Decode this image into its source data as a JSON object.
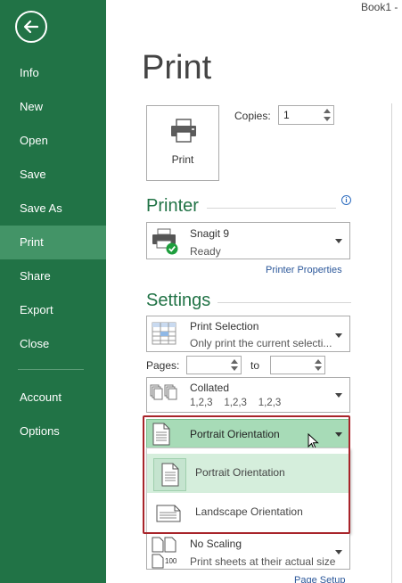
{
  "window": {
    "title": "Book1 -"
  },
  "sidebar": {
    "items": [
      {
        "label": "Info"
      },
      {
        "label": "New"
      },
      {
        "label": "Open"
      },
      {
        "label": "Save"
      },
      {
        "label": "Save As"
      },
      {
        "label": "Print"
      },
      {
        "label": "Share"
      },
      {
        "label": "Export"
      },
      {
        "label": "Close"
      },
      {
        "label": "Account"
      },
      {
        "label": "Options"
      }
    ],
    "active": "Print",
    "color": "#217346",
    "active_color": "#439467"
  },
  "page": {
    "title": "Print"
  },
  "print_button": {
    "label": "Print",
    "icon": "printer-icon"
  },
  "copies": {
    "label": "Copies:",
    "value": "1"
  },
  "printer": {
    "heading": "Printer",
    "name": "Snagit 9",
    "status": "Ready",
    "properties_link": "Printer Properties"
  },
  "settings": {
    "heading": "Settings",
    "print_what": {
      "title": "Print Selection",
      "description": "Only print the current selecti..."
    },
    "pages": {
      "label": "Pages:",
      "to_label": "to",
      "from": "",
      "to": ""
    },
    "collation": {
      "title": "Collated",
      "description": "1,2,3    1,2,3    1,2,3"
    },
    "orientation": {
      "selected": "Portrait Orientation",
      "options": [
        {
          "label": "Portrait Orientation"
        },
        {
          "label": "Landscape Orientation"
        }
      ],
      "hovered": "Portrait Orientation"
    },
    "scaling": {
      "title": "No Scaling",
      "description": "Print sheets at their actual size",
      "icon_text": "100"
    },
    "page_setup_link": "Page Setup"
  },
  "colors": {
    "accent": "#217346",
    "highlight_border": "#a8242a",
    "selected_bg": "#a7dbb7"
  }
}
